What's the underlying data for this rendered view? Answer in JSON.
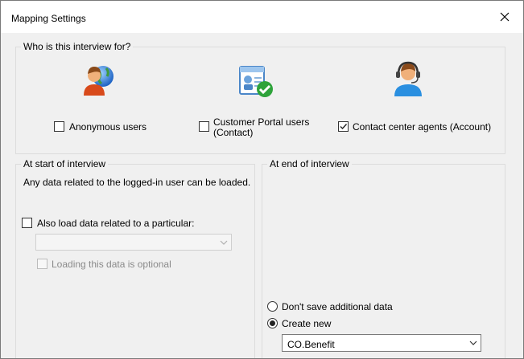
{
  "window": {
    "title": "Mapping Settings"
  },
  "who_group": {
    "legend": "Who is this interview for?",
    "options": [
      {
        "label": "Anonymous users",
        "checked": false,
        "icon": "globe-person-icon"
      },
      {
        "label_line1": "Customer Portal users",
        "label_line2": "(Contact)",
        "checked": false,
        "icon": "contact-card-check-icon"
      },
      {
        "label": "Contact center agents (Account)",
        "checked": true,
        "icon": "headset-agent-icon"
      }
    ]
  },
  "start_group": {
    "legend": "At start of interview",
    "description": "Any data related to the logged-in user can be loaded.",
    "also_load_label": "Also load data related to a particular:",
    "also_load_checked": false,
    "entity_select_value": "",
    "optional_label": "Loading this data is optional",
    "optional_checked": false
  },
  "end_group": {
    "legend": "At end of interview",
    "radio_dont_save": "Don't save additional data",
    "radio_create_new": "Create new",
    "selected_radio": "create_new",
    "create_new_select_value": "CO.Benefit"
  }
}
